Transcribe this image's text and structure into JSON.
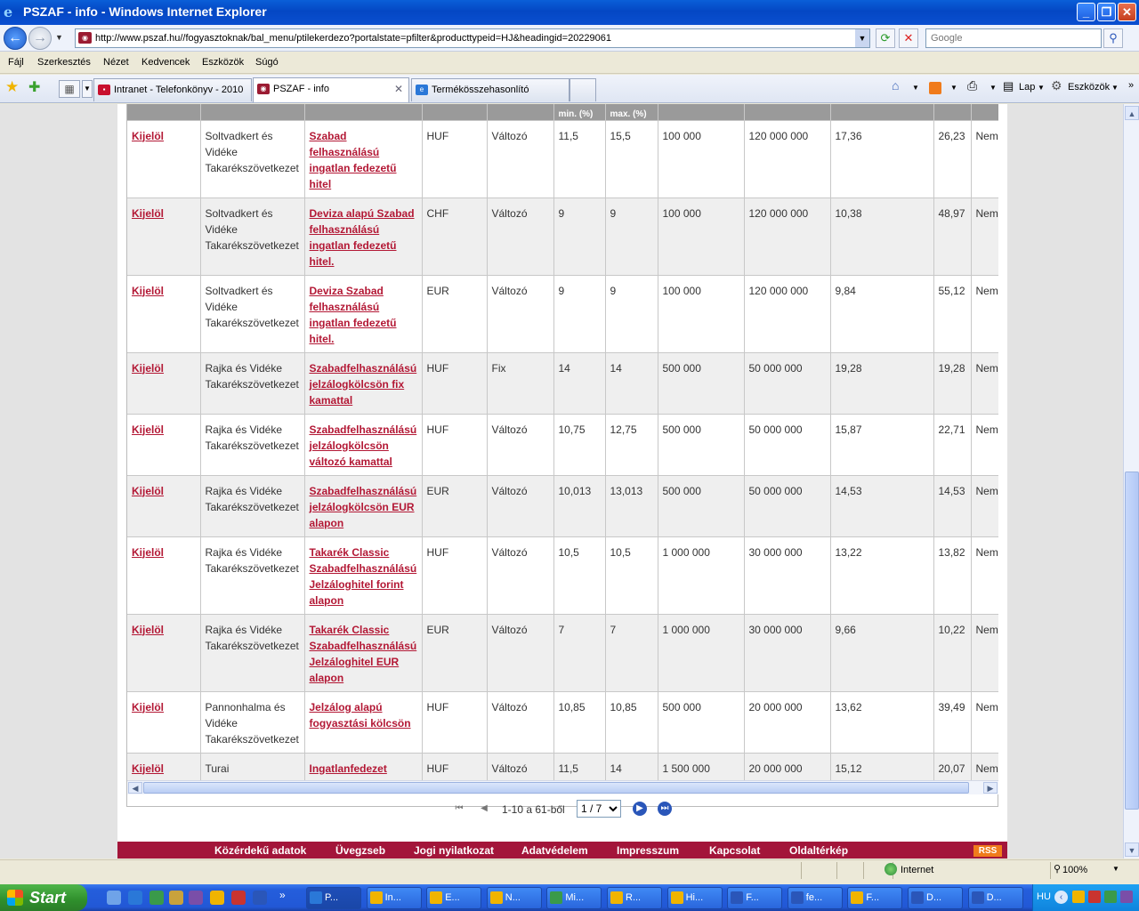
{
  "window": {
    "title": "PSZAF - info - Windows Internet Explorer"
  },
  "address": {
    "url": "http://www.pszaf.hu//fogyasztoknak/bal_menu/ptilekerdezo?portalstate=pfilter&producttypeid=HJ&headingid=20229061"
  },
  "search": {
    "placeholder": "Google"
  },
  "menu": [
    "Fájl",
    "Szerkesztés",
    "Nézet",
    "Kedvencek",
    "Eszközök",
    "Súgó"
  ],
  "tabs": [
    {
      "label": "Intranet - Telefonkönyv - 2010"
    },
    {
      "label": "PSZAF - info"
    },
    {
      "label": "Termékösszehasonlító"
    }
  ],
  "toolbar": {
    "page_label": "Lap",
    "tools_label": "Eszközök"
  },
  "table": {
    "header_partial": [
      "min. (%)",
      "max. (%)"
    ],
    "rows": [
      {
        "action": "Kijelöl",
        "bank": "Soltvadkert és Vidéke Takarékszövetkezet",
        "product": "Szabad felhasználású ingatlan fedezetű hitel",
        "currency": "HUF",
        "rate_type": "Változó",
        "rate_min": "11,5",
        "rate_max": "15,5",
        "amount_min": "100 000",
        "amount_max": "120 000 000",
        "thm_min": "17,36",
        "thm_max": "26,23",
        "flag": "Nem"
      },
      {
        "action": "Kijelöl",
        "bank": "Soltvadkert és Vidéke Takarékszövetkezet",
        "product": "Deviza alapú Szabad felhasználású ingatlan fedezetű hitel.",
        "currency": "CHF",
        "rate_type": "Változó",
        "rate_min": "9",
        "rate_max": "9",
        "amount_min": "100 000",
        "amount_max": "120 000 000",
        "thm_min": "10,38",
        "thm_max": "48,97",
        "flag": "Nem"
      },
      {
        "action": "Kijelöl",
        "bank": "Soltvadkert és Vidéke Takarékszövetkezet",
        "product": "Deviza Szabad felhasználású ingatlan fedezetű hitel.",
        "currency": "EUR",
        "rate_type": "Változó",
        "rate_min": "9",
        "rate_max": "9",
        "amount_min": "100 000",
        "amount_max": "120 000 000",
        "thm_min": "9,84",
        "thm_max": "55,12",
        "flag": "Nem"
      },
      {
        "action": "Kijelöl",
        "bank": "Rajka és Vidéke Takarékszövetkezet",
        "product": "Szabadfelhasználású jelzálogkölcsön fix kamattal",
        "currency": "HUF",
        "rate_type": "Fix",
        "rate_min": "14",
        "rate_max": "14",
        "amount_min": "500 000",
        "amount_max": "50 000 000",
        "thm_min": "19,28",
        "thm_max": "19,28",
        "flag": "Nem"
      },
      {
        "action": "Kijelöl",
        "bank": "Rajka és Vidéke Takarékszövetkezet",
        "product": "Szabadfelhasználású jelzálogkölcsön változó kamattal",
        "currency": "HUF",
        "rate_type": "Változó",
        "rate_min": "10,75",
        "rate_max": "12,75",
        "amount_min": "500 000",
        "amount_max": "50 000 000",
        "thm_min": "15,87",
        "thm_max": "22,71",
        "flag": "Nem"
      },
      {
        "action": "Kijelöl",
        "bank": "Rajka és Vidéke Takarékszövetkezet",
        "product": "Szabadfelhasználású jelzálogkölcsön EUR alapon",
        "currency": "EUR",
        "rate_type": "Változó",
        "rate_min": "10,013",
        "rate_max": "13,013",
        "amount_min": "500 000",
        "amount_max": "50 000 000",
        "thm_min": "14,53",
        "thm_max": "14,53",
        "flag": "Nem"
      },
      {
        "action": "Kijelöl",
        "bank": "Rajka és Vidéke Takarékszövetkezet",
        "product": "Takarék Classic Szabadfelhasználású Jelzáloghitel forint alapon",
        "currency": "HUF",
        "rate_type": "Változó",
        "rate_min": "10,5",
        "rate_max": "10,5",
        "amount_min": "1 000 000",
        "amount_max": "30 000 000",
        "thm_min": "13,22",
        "thm_max": "13,82",
        "flag": "Nem"
      },
      {
        "action": "Kijelöl",
        "bank": "Rajka és Vidéke Takarékszövetkezet",
        "product": "Takarék Classic Szabadfelhasználású Jelzáloghitel EUR alapon",
        "currency": "EUR",
        "rate_type": "Változó",
        "rate_min": "7",
        "rate_max": "7",
        "amount_min": "1 000 000",
        "amount_max": "30 000 000",
        "thm_min": "9,66",
        "thm_max": "10,22",
        "flag": "Nem"
      },
      {
        "action": "Kijelöl",
        "bank": "Pannonhalma és Vidéke Takarékszövetkezet",
        "product": "Jelzálog alapú fogyasztási kölcsön",
        "currency": "HUF",
        "rate_type": "Változó",
        "rate_min": "10,85",
        "rate_max": "10,85",
        "amount_min": "500 000",
        "amount_max": "20 000 000",
        "thm_min": "13,62",
        "thm_max": "39,49",
        "flag": "Nem"
      },
      {
        "action": "Kijelöl",
        "bank": "Turai Takarékszövetkezet",
        "product": "Ingatlanfedezet mellett nyújtott jelzáloghitel",
        "currency": "HUF",
        "rate_type": "Változó",
        "rate_min": "11,5",
        "rate_max": "14",
        "amount_min": "1 500 000",
        "amount_max": "20 000 000",
        "thm_min": "15,12",
        "thm_max": "20,07",
        "flag": "Nem"
      }
    ]
  },
  "pager": {
    "range_text": "1-10 a 61-ből",
    "page_value": "1 / 7"
  },
  "footer": {
    "links": [
      "Közérdekű adatok",
      "Üvegzseb",
      "Jogi nyilatkozat",
      "Adatvédelem",
      "Impresszum",
      "Kapcsolat",
      "Oldaltérkép"
    ],
    "rss": "RSS"
  },
  "status": {
    "zone": "Internet",
    "zoom": "100%"
  },
  "taskbar": {
    "start": "Start",
    "tasks": [
      "P...",
      "In...",
      "E...",
      "N...",
      "Mi...",
      "R...",
      "Hi...",
      "F...",
      "fe...",
      "F...",
      "D...",
      "D..."
    ],
    "tray_text": "HU"
  },
  "colors": {
    "accent": "#b31835",
    "footer_bg": "#a3153a",
    "titlebar": "#0a5fd8"
  }
}
